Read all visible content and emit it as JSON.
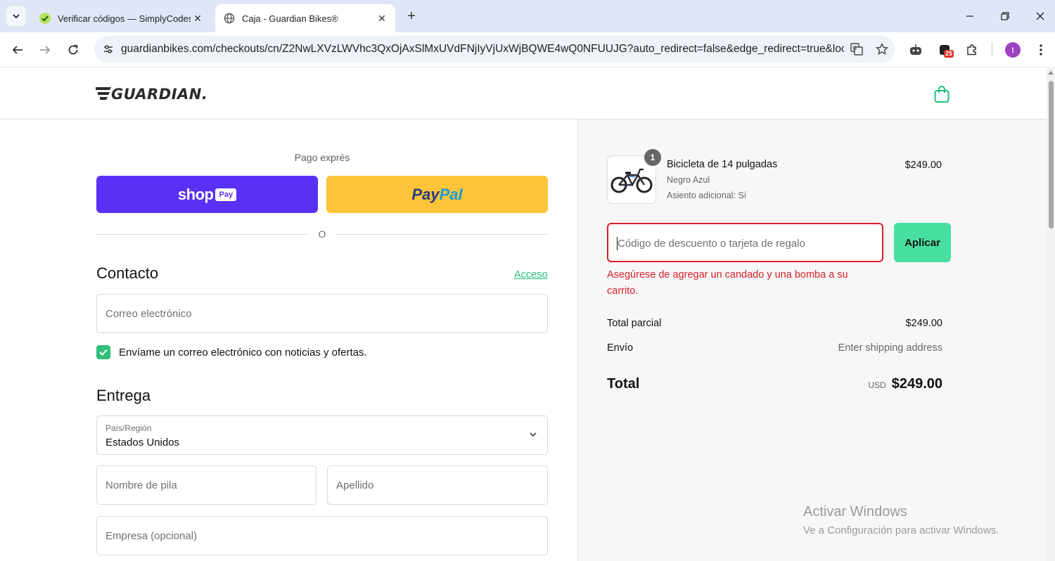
{
  "browser": {
    "tabs": [
      {
        "title": "Verificar códigos — SimplyCodes",
        "favicon": "simplycodes-icon",
        "active": false
      },
      {
        "title": "Caja - Guardian Bikes®",
        "favicon": "globe-icon",
        "active": true
      }
    ],
    "url": "guardianbikes.com/checkouts/cn/Z2NwLXVzLWVhc3QxOjAxSlMxUVdFNjIyVjUxWjBQWE4wQ0NFUUJG?auto_redirect=false&edge_redirect=true&loc...",
    "extension_badge": "25",
    "profile_initial": "t"
  },
  "header": {
    "logo_text": "GUARDIAN."
  },
  "express": {
    "title": "Pago exprés",
    "shop_word": "shop",
    "shop_pay": "Pay",
    "paypal_1": "Pay",
    "paypal_2": "Pal",
    "divider": "O"
  },
  "contact": {
    "heading": "Contacto",
    "login_link": "Acceso",
    "email_placeholder": "Correo electrónico",
    "newsletter_label": "Envíame un correo electrónico con noticias y ofertas.",
    "newsletter_checked": true
  },
  "delivery": {
    "heading": "Entrega",
    "country_label": "País/Región",
    "country_value": "Estados Unidos",
    "first_name_placeholder": "Nombre de pila",
    "last_name_placeholder": "Apellido",
    "company_placeholder": "Empresa (opcional)"
  },
  "summary": {
    "item": {
      "quantity": "1",
      "name": "Bicicleta de 14 pulgadas",
      "variant": "Negro Azul",
      "extra": "Asiento adicional: Sí",
      "price": "$249.00"
    },
    "discount_placeholder": "Código de descuento o tarjeta de regalo",
    "apply_label": "Aplicar",
    "error": "Asegúrese de agregar un candado y una bomba a su carrito.",
    "subtotal_label": "Total parcial",
    "subtotal_value": "$249.00",
    "shipping_label": "Envío",
    "shipping_value": "Enter shipping address",
    "total_label": "Total",
    "currency": "USD",
    "total_value": "$249.00"
  },
  "watermark": {
    "line1": "Activar Windows",
    "line2": "Ve a Configuración para activar Windows."
  },
  "colors": {
    "shop_pay": "#5a31f4",
    "paypal": "#ffc439",
    "accent_green": "#48e0a1",
    "error_red": "#d42129"
  }
}
